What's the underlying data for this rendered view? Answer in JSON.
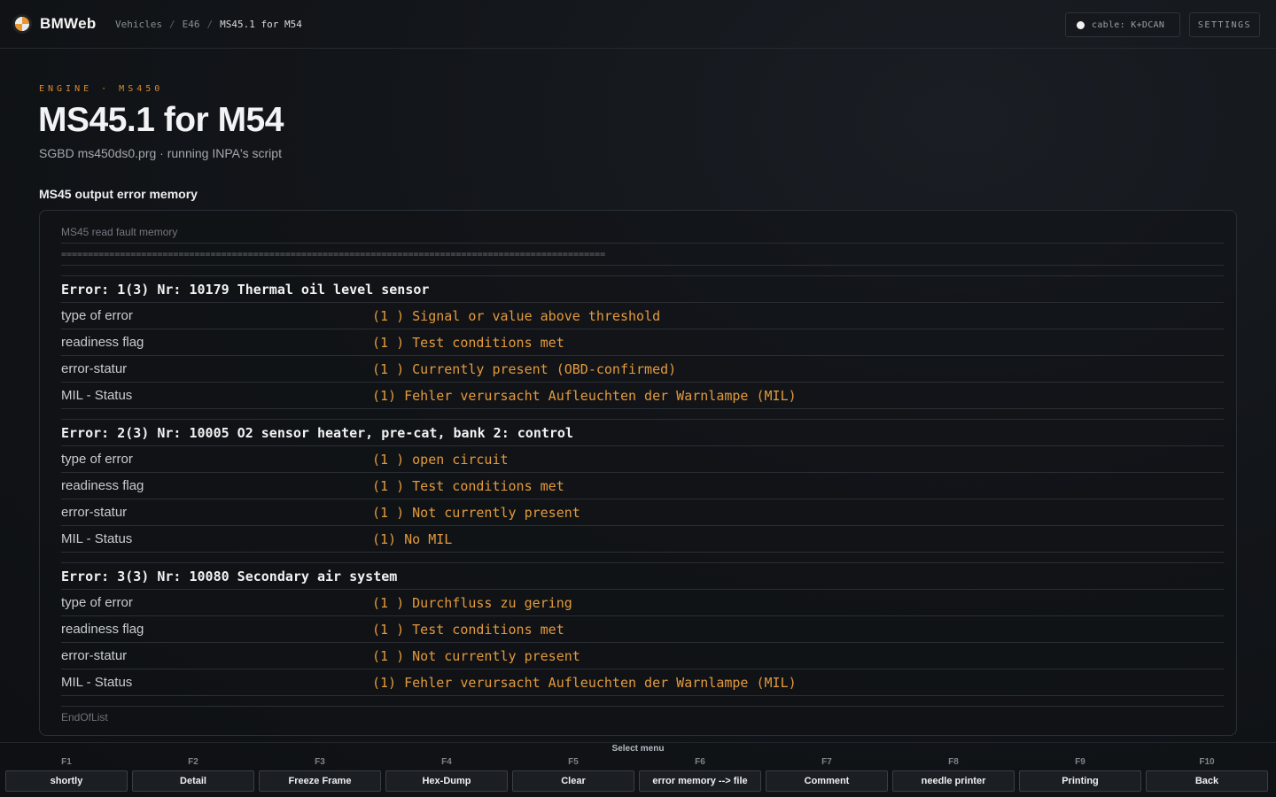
{
  "app": {
    "name": "BMWeb"
  },
  "breadcrumb": {
    "items": [
      "Vehicles",
      "E46",
      "MS45.1 for M54"
    ],
    "separator": "/"
  },
  "header": {
    "cable_label": "cable: K+DCAN",
    "settings_label": "SETTINGS"
  },
  "page": {
    "eyebrow": "ENGINE · MS450",
    "title": "MS45.1 for M54",
    "subtitle": "SGBD ms450ds0.prg · running INPA's script",
    "section_title": "MS45 output error memory"
  },
  "output": {
    "header_line": "MS45 read fault memory",
    "separator_line": "======================================================================================================",
    "errors": [
      {
        "heading": "Error: 1(3) Nr: 10179 Thermal oil level sensor",
        "fields": [
          {
            "key": "type of error",
            "value": "(1 ) Signal or value above threshold"
          },
          {
            "key": "readiness flag",
            "value": "(1 ) Test conditions met"
          },
          {
            "key": "error-statur",
            "value": "(1 ) Currently present (OBD-confirmed)"
          },
          {
            "key": "MIL - Status",
            "value": "(1) Fehler verursacht Aufleuchten der Warnlampe (MIL)"
          }
        ]
      },
      {
        "heading": "Error: 2(3) Nr: 10005 O2 sensor heater, pre-cat, bank 2: control",
        "fields": [
          {
            "key": "type of error",
            "value": "(1 ) open circuit"
          },
          {
            "key": "readiness flag",
            "value": "(1 ) Test conditions met"
          },
          {
            "key": "error-statur",
            "value": "(1 ) Not currently present"
          },
          {
            "key": "MIL - Status",
            "value": "(1) No MIL"
          }
        ]
      },
      {
        "heading": "Error: 3(3) Nr: 10080 Secondary air system",
        "fields": [
          {
            "key": "type of error",
            "value": "(1 ) Durchfluss zu gering"
          },
          {
            "key": "readiness flag",
            "value": "(1 ) Test conditions met"
          },
          {
            "key": "error-statur",
            "value": "(1 ) Not currently present"
          },
          {
            "key": "MIL - Status",
            "value": "(1) Fehler verursacht Aufleuchten der Warnlampe (MIL)"
          }
        ]
      }
    ],
    "footer_line": "EndOfList"
  },
  "fkeys": {
    "title": "Select menu",
    "keys": [
      {
        "key": "F1",
        "label": "shortly"
      },
      {
        "key": "F2",
        "label": "Detail"
      },
      {
        "key": "F3",
        "label": "Freeze Frame"
      },
      {
        "key": "F4",
        "label": "Hex-Dump"
      },
      {
        "key": "F5",
        "label": "Clear"
      },
      {
        "key": "F6",
        "label": "error memory --> file"
      },
      {
        "key": "F7",
        "label": "Comment"
      },
      {
        "key": "F8",
        "label": "needle printer"
      },
      {
        "key": "F9",
        "label": "Printing"
      },
      {
        "key": "F10",
        "label": "Back"
      }
    ]
  },
  "colors": {
    "accent": "#e39a3c",
    "background": "#111418"
  }
}
